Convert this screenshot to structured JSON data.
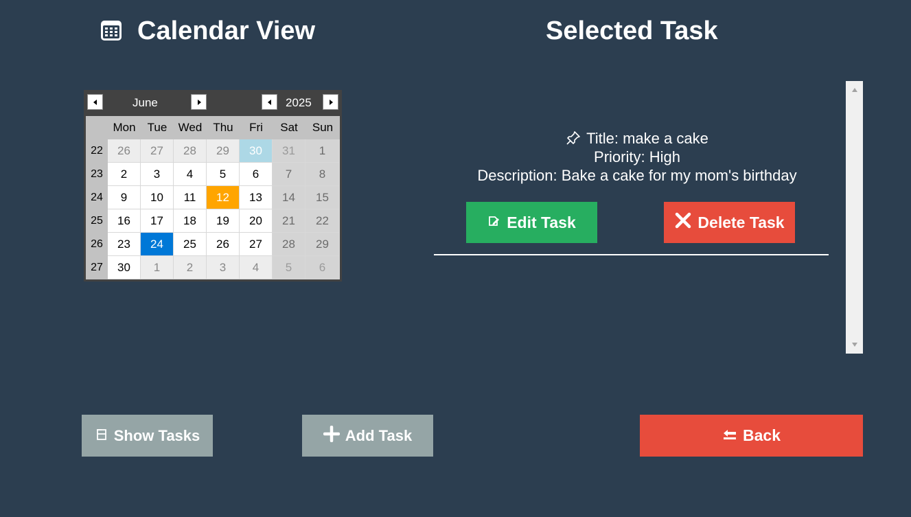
{
  "headings": {
    "calendar": "Calendar View",
    "selected_task": "Selected Task"
  },
  "calendar": {
    "month": "June",
    "year": "2025",
    "weekday_headers": [
      "Mon",
      "Tue",
      "Wed",
      "Thu",
      "Fri",
      "Sat",
      "Sun"
    ],
    "weeks": [
      {
        "week": "22",
        "days": [
          "26",
          "27",
          "28",
          "29",
          "30",
          "31",
          "1"
        ]
      },
      {
        "week": "23",
        "days": [
          "2",
          "3",
          "4",
          "5",
          "6",
          "7",
          "8"
        ]
      },
      {
        "week": "24",
        "days": [
          "9",
          "10",
          "11",
          "12",
          "13",
          "14",
          "15"
        ]
      },
      {
        "week": "25",
        "days": [
          "16",
          "17",
          "18",
          "19",
          "20",
          "21",
          "22"
        ]
      },
      {
        "week": "26",
        "days": [
          "23",
          "24",
          "25",
          "26",
          "27",
          "28",
          "29"
        ]
      },
      {
        "week": "27",
        "days": [
          "30",
          "1",
          "2",
          "3",
          "4",
          "5",
          "6"
        ]
      }
    ],
    "today": "12",
    "selected": "24",
    "colors": {
      "today": "#ffa500",
      "selected": "#0078d7",
      "highlighted_other": "#add8e6"
    }
  },
  "task": {
    "title": "Title: make a cake",
    "priority": "Priority: High",
    "description": "Description: Bake a cake for my mom's birthday"
  },
  "buttons": {
    "edit": "Edit Task",
    "delete": "Delete Task",
    "show_tasks": "Show Tasks",
    "add_task": "Add Task",
    "back": "Back"
  },
  "colors": {
    "background": "#2c3e50",
    "edit": "#27ae60",
    "delete": "#e74c3c",
    "neutral": "#95a5a6",
    "back": "#e74c3c"
  }
}
